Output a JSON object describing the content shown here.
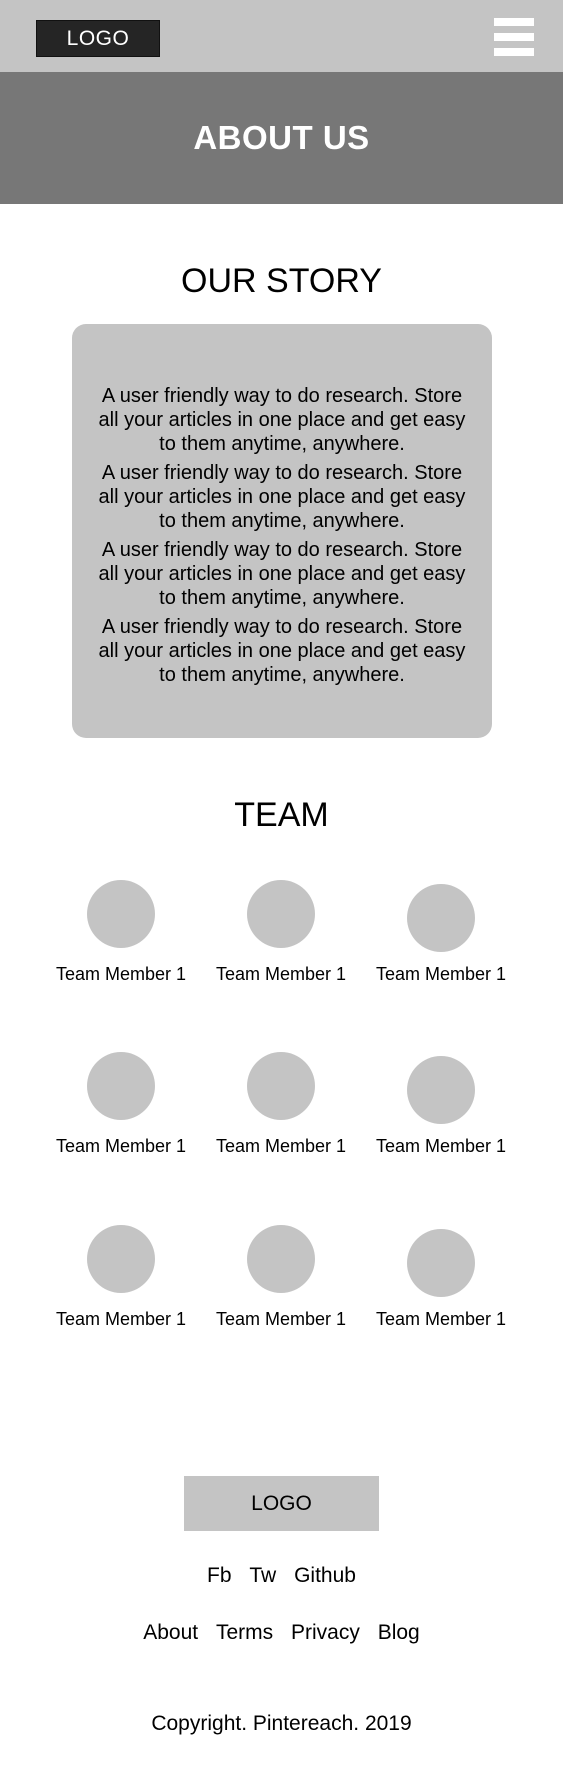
{
  "header": {
    "logo_label": "LOGO",
    "menu_icon": "hamburger-icon",
    "hero_title": "ABOUT US"
  },
  "story": {
    "title": "OUR STORY",
    "paragraphs": [
      "A user friendly way to do research. Store all your articles in one place and get easy to them anytime, anywhere.",
      "A user friendly way to do research. Store all your articles in one place and get easy to them anytime, anywhere.",
      "A user friendly way to do research. Store all your articles in one place and get easy to them anytime, anywhere.",
      "A user friendly way to do research. Store all your articles in one place and get easy to them anytime, anywhere."
    ]
  },
  "team": {
    "title": "TEAM",
    "members": [
      "Team Member 1",
      "Team Member 1",
      "Team Member 1",
      "Team Member 1",
      "Team Member 1",
      "Team Member 1",
      "Team Member 1",
      "Team Member 1",
      "Team Member 1"
    ]
  },
  "footer": {
    "logo_label": "LOGO",
    "social": [
      "Fb",
      "Tw",
      "Github"
    ],
    "nav": [
      "About",
      "Terms",
      "Privacy",
      "Blog"
    ],
    "copyright": "Copyright. Pintereach. 2019"
  },
  "colors": {
    "topbar": "#c4c4c4",
    "hero": "#777777",
    "logo_button": "#252525",
    "placeholder_gray": "#c4c4c4"
  }
}
